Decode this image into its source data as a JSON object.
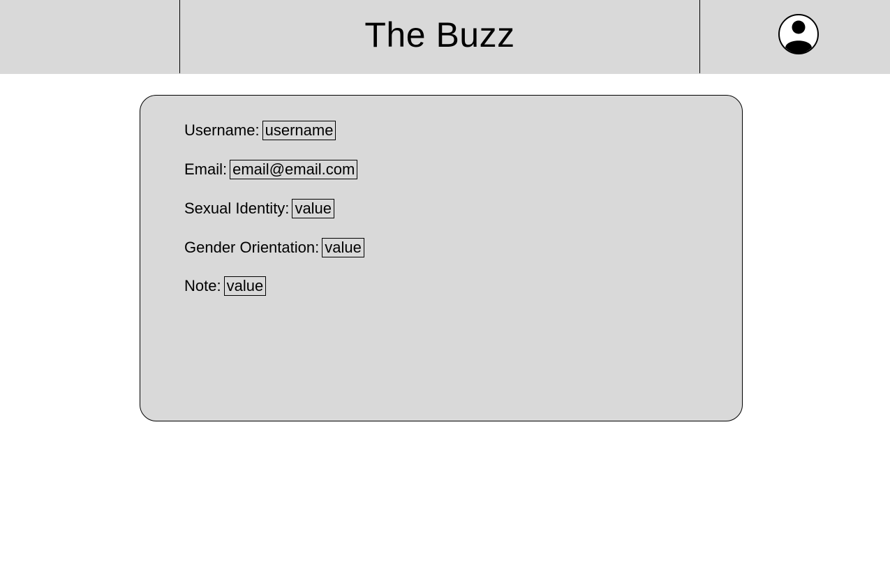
{
  "header": {
    "title": "The Buzz",
    "account_icon": "account-circle-icon"
  },
  "profile": {
    "fields": [
      {
        "label": "Username:",
        "value": "username"
      },
      {
        "label": "Email:",
        "value": "email@email.com"
      },
      {
        "label": "Sexual Identity:",
        "value": "value"
      },
      {
        "label": "Gender Orientation:",
        "value": "value"
      },
      {
        "label": "Note:",
        "value": "value"
      }
    ]
  },
  "colors": {
    "header_bg": "#d9d9d9",
    "card_bg": "#d9d9d9",
    "border": "#000000",
    "page_bg": "#ffffff"
  }
}
